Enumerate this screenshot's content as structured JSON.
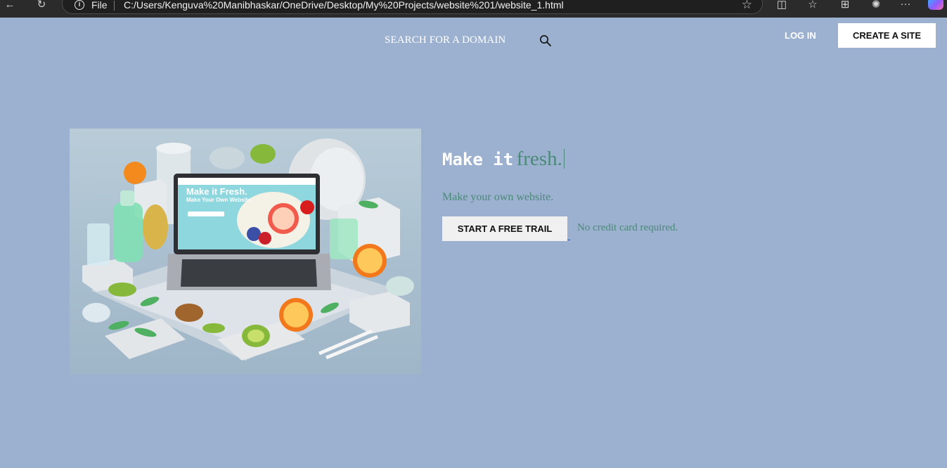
{
  "browser": {
    "scheme": "File",
    "url": "C:/Users/Kenguva%20Manibhaskar/OneDrive/Desktop/My%20Projects/website%201/website_1.html"
  },
  "header": {
    "search_label": "SEARCH FOR A DOMAIN",
    "login_label": "LOG IN",
    "create_label": "CREATE A SITE"
  },
  "hero": {
    "headline_mono": "Make it",
    "headline_serif": "fresh.",
    "subline": "Make your own website.",
    "cta_label": "START A FREE TRAIL",
    "note": "No credit card required.",
    "image": {
      "screen_title": "Make it Fresh.",
      "screen_subtitle": "Make Your Own Website"
    }
  },
  "colors": {
    "page_background": "#9cb1cf",
    "accent_text": "#4a8a78",
    "button_background": "#ffffff"
  }
}
